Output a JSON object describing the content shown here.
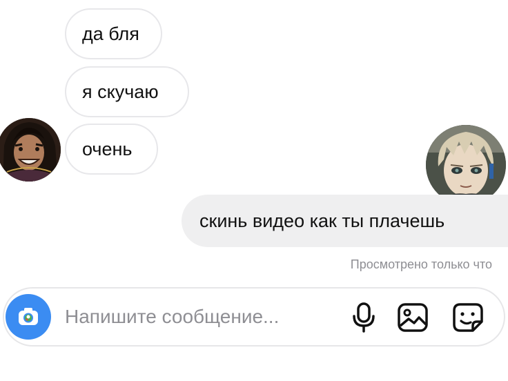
{
  "conversation": {
    "incoming": [
      {
        "text": "да бля"
      },
      {
        "text": "я скучаю"
      },
      {
        "text": "очень"
      }
    ],
    "outgoing": [
      {
        "text": "скинь видео как ты плачешь"
      }
    ],
    "seen_status": "Просмотрено только что"
  },
  "composer": {
    "placeholder": "Напишите сообщение..."
  },
  "icons": {
    "camera": "camera-icon",
    "mic": "microphone-icon",
    "gallery": "image-gallery-icon",
    "sticker": "sticker-icon"
  },
  "colors": {
    "accent": "#3b8cf2",
    "outgoing_bubble": "#efeff0",
    "incoming_border": "#e7e7ea",
    "muted_text": "#8e8e93"
  }
}
